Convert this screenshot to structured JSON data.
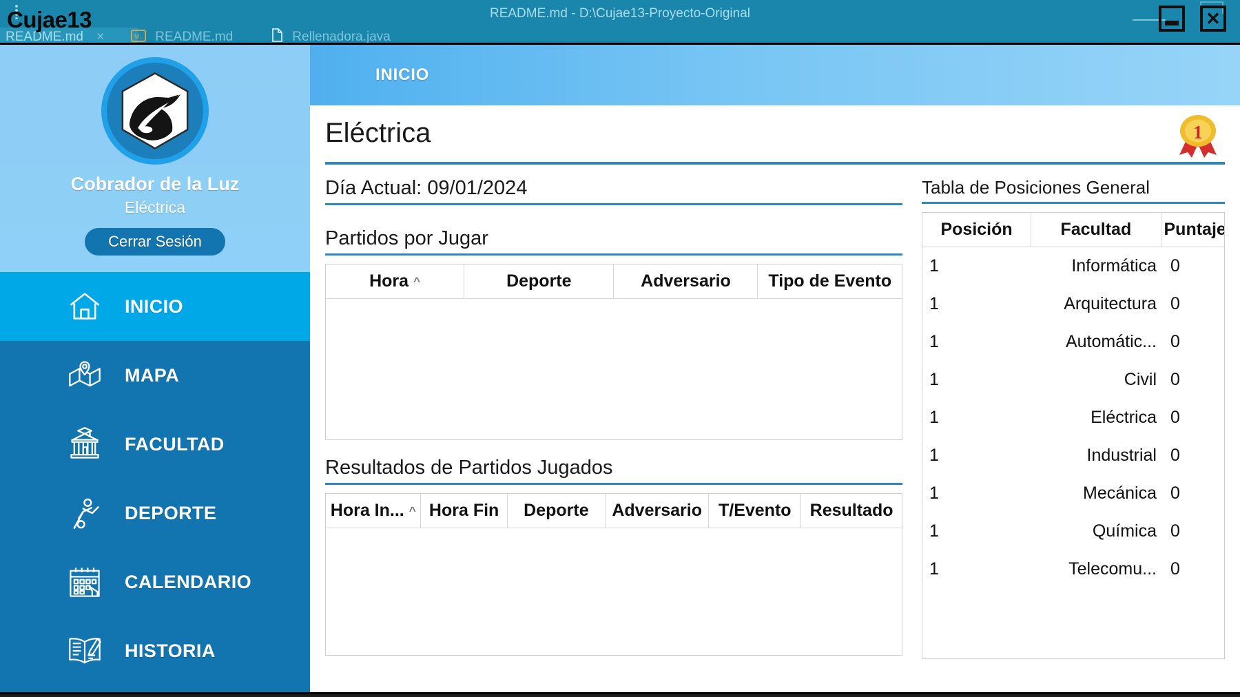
{
  "background_editor": {
    "window_title": "README.md - D:\\Cujae13-Proyecto-Original",
    "menu_icon": "kebab-menu-icon",
    "tabs": [
      {
        "label": "README.md",
        "close": "×",
        "icon": "",
        "active": false
      },
      {
        "label": "README.md",
        "close": "",
        "icon": "markdown-file-icon",
        "active": true
      },
      {
        "label": "Rellenadora.java",
        "close": "",
        "icon": "java-file-icon",
        "active": false
      }
    ]
  },
  "app_window": {
    "title": "Cujae13",
    "minimize_glyph": "–",
    "close_glyph": "✕"
  },
  "sidebar": {
    "avatar_icon": "cujae-shield-logo",
    "profile_name": "Cobrador de la Luz",
    "profile_faculty": "Eléctrica",
    "logout_label": "Cerrar Sesión",
    "items": [
      {
        "label": "INICIO",
        "icon": "home-icon",
        "active": true
      },
      {
        "label": "MAPA",
        "icon": "map-icon",
        "active": false
      },
      {
        "label": "FACULTAD",
        "icon": "building-icon",
        "active": false
      },
      {
        "label": "DEPORTE",
        "icon": "athlete-icon",
        "active": false
      },
      {
        "label": "CALENDARIO",
        "icon": "calendar-icon",
        "active": false
      },
      {
        "label": "HISTORIA",
        "icon": "book-icon",
        "active": false
      }
    ]
  },
  "header": {
    "breadcrumb": "INICIO"
  },
  "main": {
    "page_title": "Eléctrica",
    "medal_icon": "gold-medal-icon",
    "medal_number": "1",
    "day_label": "Día Actual: 09/01/2024",
    "upcoming": {
      "title": "Partidos por Jugar",
      "columns": [
        "Hora",
        "Deporte",
        "Adversario",
        "Tipo de Evento"
      ],
      "sorted_column": "Hora",
      "sort_caret": "^",
      "rows": []
    },
    "results": {
      "title": "Resultados de Partidos Jugados",
      "columns": [
        "Hora In...",
        "Hora Fin",
        "Deporte",
        "Adversario",
        "T/Evento",
        "Resultado"
      ],
      "sorted_column": "Hora In...",
      "sort_caret": "^",
      "rows": []
    },
    "ranking": {
      "title": "Tabla de Posiciones General",
      "columns": [
        "Posición",
        "Facultad",
        "Puntaje"
      ],
      "rows": [
        {
          "pos": "1",
          "facultad": "Informática",
          "puntaje": "0"
        },
        {
          "pos": "1",
          "facultad": "Arquitectura",
          "puntaje": "0"
        },
        {
          "pos": "1",
          "facultad": "Automátic...",
          "puntaje": "0"
        },
        {
          "pos": "1",
          "facultad": "Civil",
          "puntaje": "0"
        },
        {
          "pos": "1",
          "facultad": "Eléctrica",
          "puntaje": "0"
        },
        {
          "pos": "1",
          "facultad": "Industrial",
          "puntaje": "0"
        },
        {
          "pos": "1",
          "facultad": "Mecánica",
          "puntaje": "0"
        },
        {
          "pos": "1",
          "facultad": "Química",
          "puntaje": "0"
        },
        {
          "pos": "1",
          "facultad": "Telecomu...",
          "puntaje": "0"
        }
      ]
    }
  },
  "colors": {
    "titlebar": "#1b86ab",
    "sidebar": "#1275b0",
    "sidebar_active": "#00a8e8",
    "profile_bg": "#8ecdf5",
    "header_gradient_start": "#4fb0ef",
    "header_gradient_end": "#97d4f8",
    "accent_underline": "#2e86c1",
    "medal_gold": "#f0bc2c",
    "medal_ribbon": "#d32f2f"
  }
}
